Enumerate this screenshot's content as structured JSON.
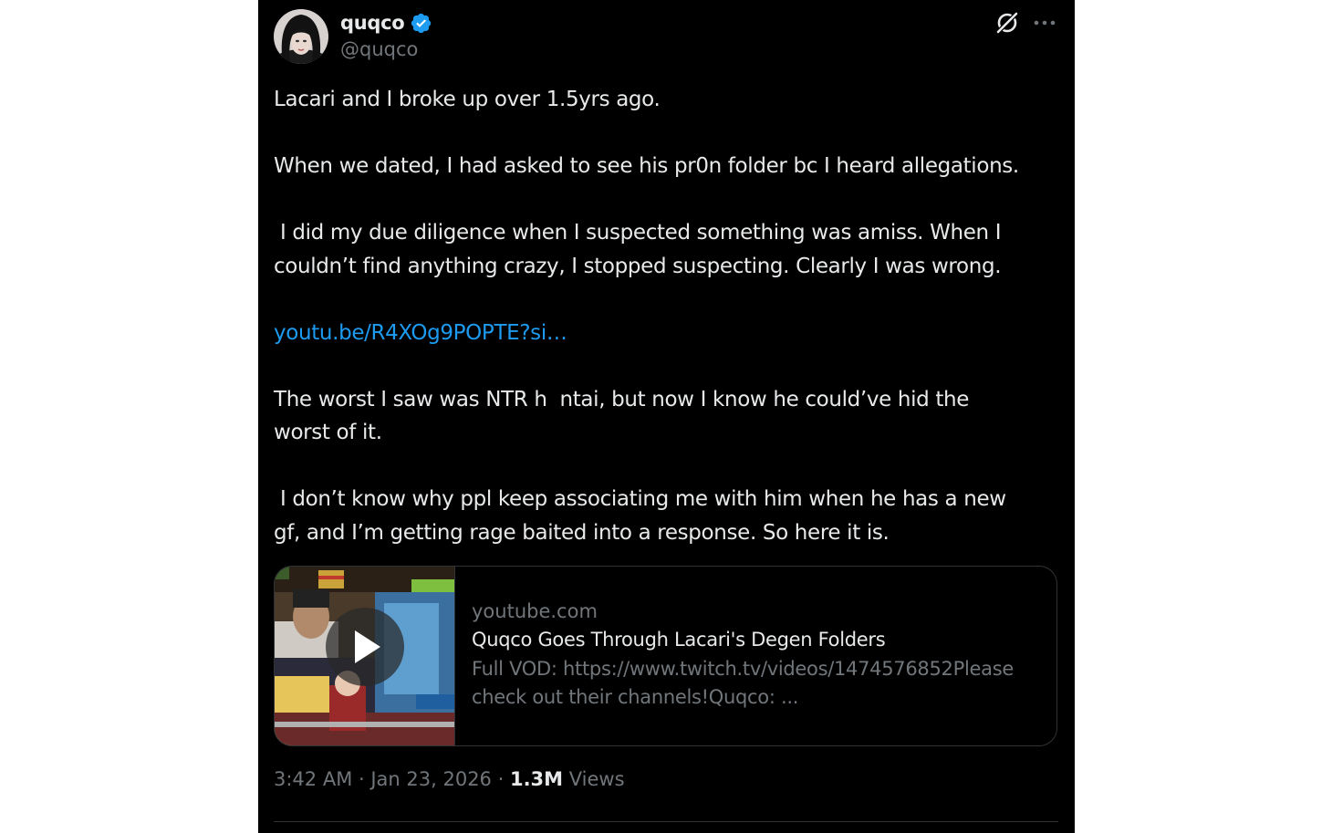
{
  "tweet": {
    "display_name": "quqco",
    "handle": "@quqco",
    "verified_badge_color": "#1d9bf0",
    "avatar_icon": "profile-photo",
    "header_icons": [
      "grok-icon",
      "more-icon"
    ],
    "paragraphs": [
      {
        "lines": [
          "Lacari and I broke up over 1.5yrs ago."
        ]
      },
      {
        "lines": [
          "When we dated, I had asked to see his pr0n folder bc I heard allegations."
        ]
      },
      {
        "lines": [
          " I did my due diligence when I suspected something was amiss. When I",
          "couldn’t find anything crazy, I stopped suspecting. Clearly I was wrong."
        ]
      },
      {
        "lines": [
          "youtu.be/R4XOg9POPTE?si…"
        ],
        "link": true
      },
      {
        "lines": [
          "The worst I saw was NTR h  ntai, but now I know he could’ve hid the",
          "worst of it."
        ]
      },
      {
        "lines": [
          " I don’t know why ppl keep associating me with him when he has a new",
          "gf, and I’m getting rage baited into a response. So here it is."
        ]
      }
    ],
    "link_color": "#1d9bf0"
  },
  "card": {
    "domain": "youtube.com",
    "title": "Quqco Goes Through Lacari's Degen Folders",
    "description_lines": [
      "Full VOD: https://www.twitch.tv/videos/1474576852Please",
      "check out their channels!Quqco: ..."
    ],
    "play_icon": "play-icon"
  },
  "meta": {
    "time": "3:42 AM",
    "separator": " · ",
    "date": "Jan 23, 2026",
    "views_count": "1.3M",
    "views_label": "Views"
  }
}
